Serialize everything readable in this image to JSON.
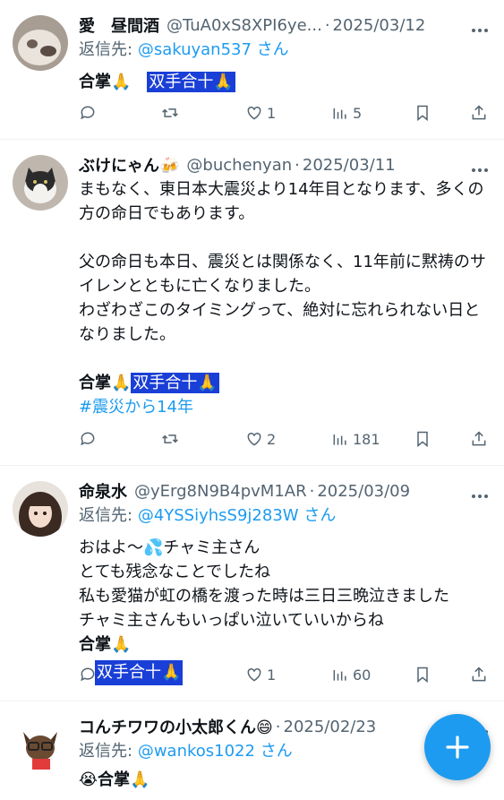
{
  "tweets": [
    {
      "name": "愛　昼間酒",
      "handle": "@TuA0xS8XPI6ye...",
      "sep": "·",
      "date": "2025/03/12",
      "reply_prefix": "返信先:",
      "reply_to": "@sakuyan537",
      "reply_suffix": "さん",
      "bold_text": "合掌",
      "emoji": "🙏",
      "highlight": "双手合十🙏",
      "actions": {
        "reply": "",
        "retweet": "",
        "like": "1",
        "views": "5"
      }
    },
    {
      "name": "ぶけにゃん🍻",
      "handle": "@buchenyan",
      "sep": "·",
      "date": "2025/03/11",
      "body": "まもなく、東日本大震災より14年目となります、多くの方の命日でもあります。\n\n父の命日も本日、震災とは関係なく、11年前に黙祷のサイレンとともに亡くなりました。\nわざわざこのタイミングって、絶対に忘れられない日となりました。",
      "bold_text": "合掌",
      "emoji": "🙏",
      "highlight": "双手合十🙏",
      "hashtag": "#震災から14年",
      "actions": {
        "reply": "",
        "retweet": "",
        "like": "2",
        "views": "181"
      }
    },
    {
      "name": "命泉水",
      "handle": "@yErg8N9B4pvM1AR",
      "sep": "·",
      "date": "2025/03/09",
      "reply_prefix": "返信先:",
      "reply_to": "@4YSSiyhsS9j283W",
      "reply_suffix": "さん",
      "body": "おはよ〜💦チャミ主さん\nとても残念なことでしたね\n私も愛猫が虹の橋を渡った時は三日三晩泣きました\nチャミ主さんもいっぱい泣いていいからね",
      "bold_text": "合掌",
      "emoji": "🙏",
      "highlight": "双手合十🙏",
      "actions": {
        "reply": "",
        "retweet": "",
        "like": "1",
        "views": "60"
      }
    },
    {
      "name": "コんチワワの小太郎くん😄",
      "sep": "·",
      "date": "2025/02/23",
      "reply_prefix": "返信先:",
      "reply_to": "@wankos1022",
      "reply_suffix": "さん",
      "body_prefix": "😭",
      "bold_text": "合掌",
      "emoji": "🙏"
    }
  ],
  "fab": {
    "icon": "plus-icon",
    "label": "+"
  },
  "colors": {
    "link": "#1d9bf0",
    "muted": "#536471",
    "highlight": "#1a3fd6",
    "fab": "#1d9bf0"
  }
}
